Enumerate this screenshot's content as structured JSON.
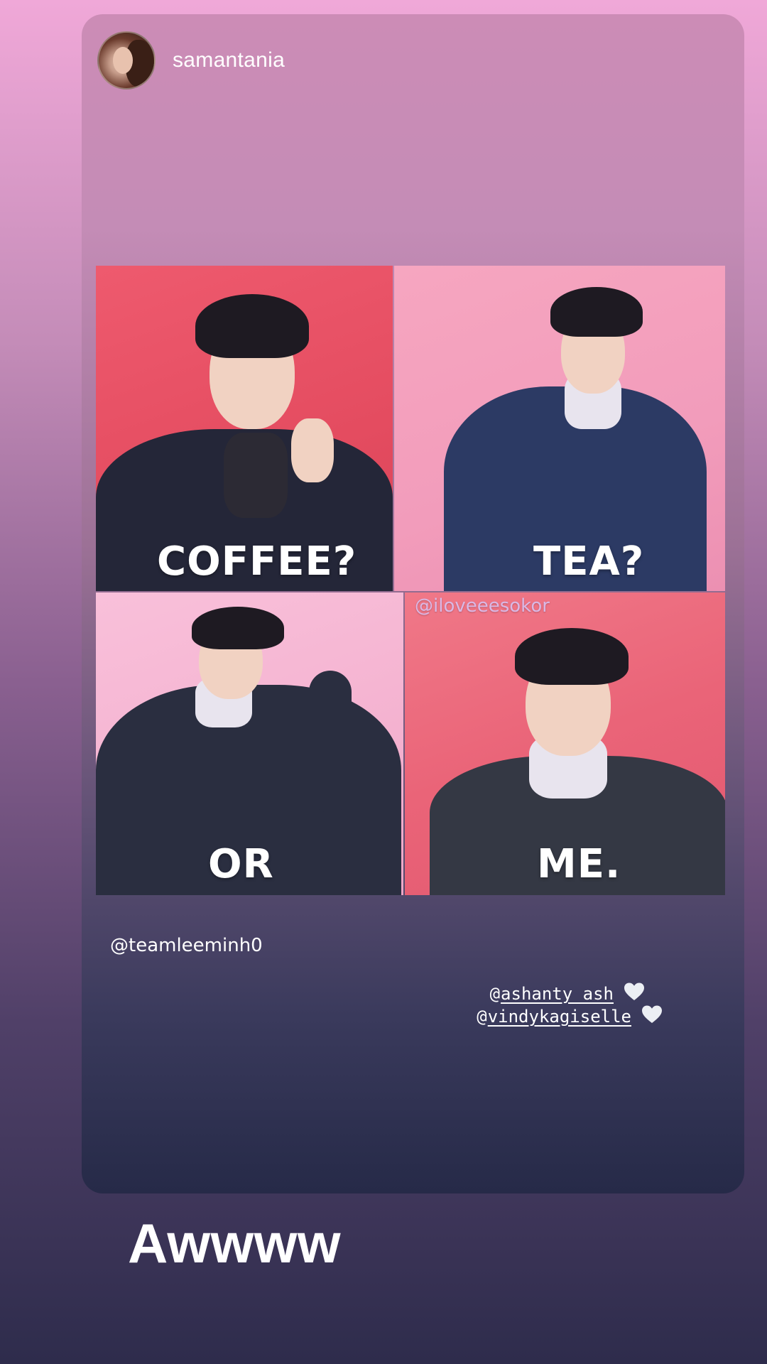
{
  "story": {
    "author": {
      "username": "samantania",
      "avatar_icon": "profile-photo"
    },
    "meme": {
      "captions": [
        "COFFEE?",
        "TEA?",
        "OR",
        "ME."
      ],
      "watermark": "@iloveeesokor"
    },
    "source_tag": "@teamleeminh0",
    "mentions": [
      {
        "at": "@",
        "handle": "ashanty_ash",
        "icon": "white-heart-icon"
      },
      {
        "at": "@",
        "handle": "vindykagiselle",
        "icon": "white-heart-icon"
      }
    ]
  },
  "reply": {
    "text": "Awwww"
  },
  "colors": {
    "panel_red": "#e44c60",
    "panel_pink": "#f29cbb",
    "panel_light_pink": "#f4b2d0",
    "panel_coral": "#ea6478",
    "text": "#ffffff"
  }
}
